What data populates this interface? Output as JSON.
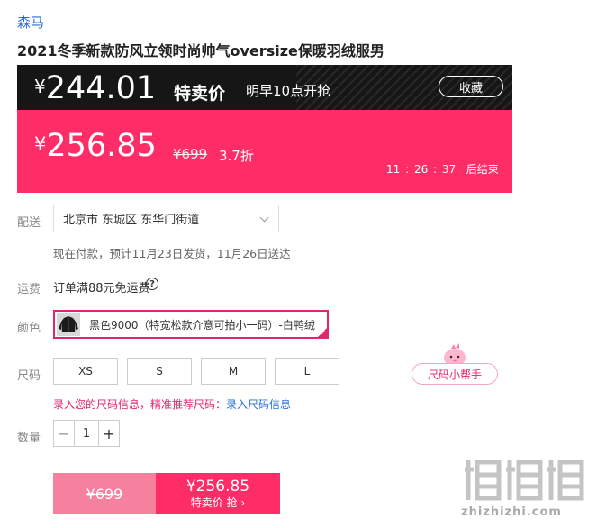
{
  "product": {
    "brand": "森马",
    "title": "2021冬季新款防风立领时尚帅气oversize保暖羽绒服男"
  },
  "promo": {
    "currency": "¥",
    "price": "244.01",
    "label": "特卖价",
    "time_text": "明早10点开抢",
    "favorite_label": "收藏"
  },
  "price": {
    "currency": "¥",
    "current": "256.85",
    "original": "¥699",
    "discount": "3.7折",
    "countdown": "11 : 26 : 37",
    "countdown_suffix": "后结束"
  },
  "delivery": {
    "label": "配送",
    "address": "北京市 东城区 东华门街道",
    "info": "现在付款，预计11月23日发货，11月26日送达"
  },
  "shipping": {
    "label": "运费",
    "text": "订单满88元免运费"
  },
  "color": {
    "label": "颜色",
    "selected": "黑色9000（特宽松款介意可拍小一码）-白鸭绒"
  },
  "size": {
    "label": "尺码",
    "options": [
      "XS",
      "S",
      "M",
      "L"
    ],
    "helper": "尺码小帮手",
    "info_prefix": "录入您的尺码信息，精准推荐尺码：",
    "info_link": "录入尺码信息"
  },
  "quantity": {
    "label": "数量",
    "value": "1",
    "minus": "−",
    "plus": "+"
  },
  "buy": {
    "original": "¥699",
    "price": "¥256.85",
    "action": "特卖价 抢 ›"
  },
  "watermark": {
    "text": "zhizhizhi.com"
  },
  "colors": {
    "accent": "#ff2d67",
    "promo_bg": "#161616",
    "link": "#2a6fd6"
  }
}
